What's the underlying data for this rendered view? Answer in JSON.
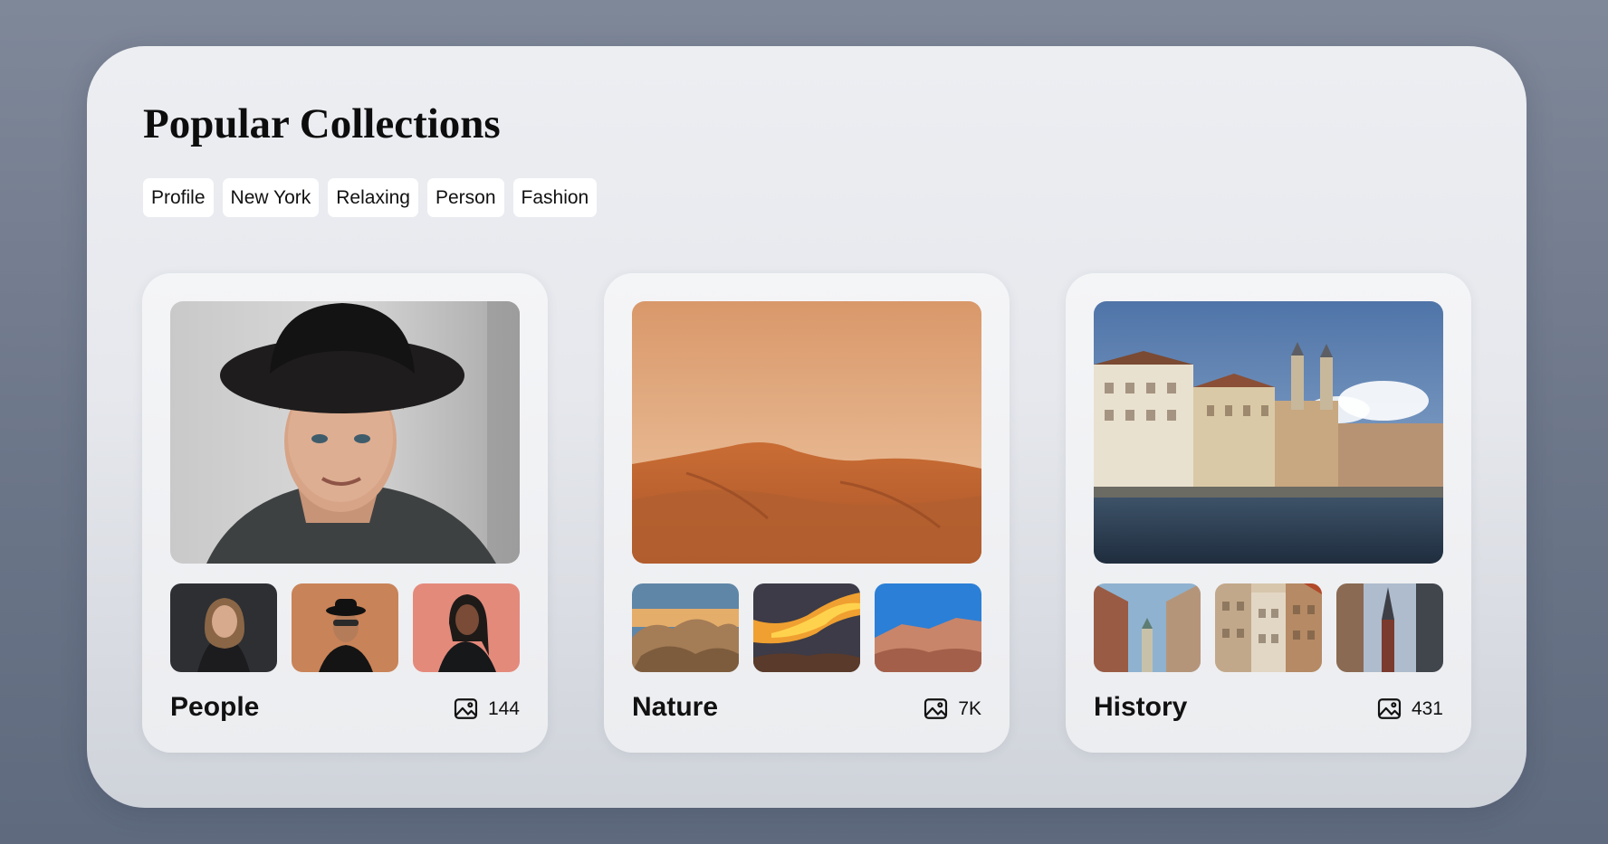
{
  "page": {
    "title": "Popular Collections"
  },
  "tags": [
    {
      "label": "Profile"
    },
    {
      "label": "New York"
    },
    {
      "label": "Relaxing"
    },
    {
      "label": "Person"
    },
    {
      "label": "Fashion"
    }
  ],
  "collections": [
    {
      "name": "People",
      "count": "144",
      "hero_image": "portrait-man-curly-hair-black-hat",
      "thumbnails": [
        "portrait-woman-dark-background",
        "man-sunglasses-black-hat-orange-wall",
        "woman-pink-background"
      ]
    },
    {
      "name": "Nature",
      "count": "7K",
      "hero_image": "desert-sand-dunes",
      "thumbnails": [
        "desert-rocks-sunset",
        "orange-cloud-desert-sky",
        "red-rock-canyon-blue-sky"
      ]
    },
    {
      "name": "History",
      "count": "431",
      "hero_image": "old-town-riverside-church-towers",
      "thumbnails": [
        "narrow-street-clock-tower",
        "ornate-old-buildings",
        "church-spire-between-buildings"
      ]
    }
  ],
  "icons": {
    "count_icon": "image-icon"
  },
  "colors": {
    "background": "#6c7689",
    "panel": "#e6e8ed",
    "card": "#f2f3f5",
    "tag_bg": "#ffffff",
    "text": "#111111"
  }
}
